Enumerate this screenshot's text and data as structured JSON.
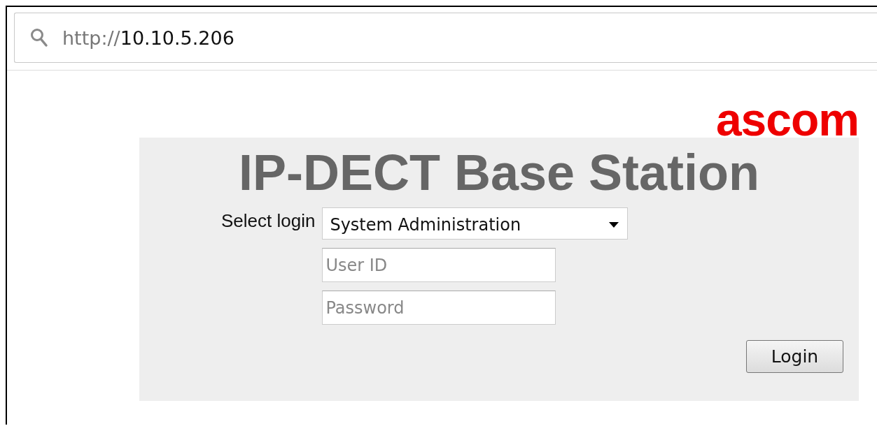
{
  "address_bar": {
    "scheme": "http://",
    "host": "10.10.5.206"
  },
  "logo": "ascom",
  "title": "IP-DECT Base Station",
  "login_form": {
    "select_label": "Select login",
    "select_value": "System Administration",
    "user_id": {
      "placeholder": "User ID"
    },
    "password": {
      "placeholder": "Password"
    },
    "button": "Login"
  }
}
